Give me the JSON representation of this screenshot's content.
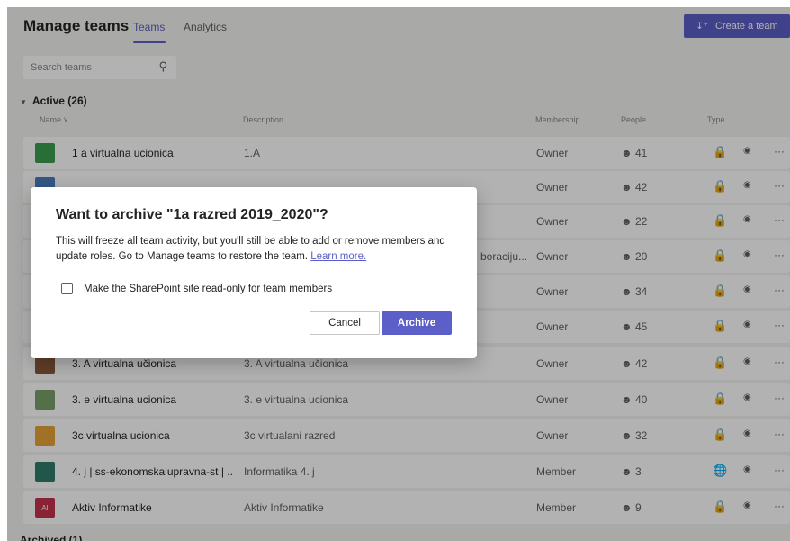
{
  "header": {
    "title": "Manage teams",
    "tabs": [
      {
        "label": "Teams",
        "active": true
      },
      {
        "label": "Analytics",
        "active": false
      }
    ],
    "create_button": {
      "label": "Create a team",
      "icon": "add-team-icon"
    }
  },
  "search": {
    "placeholder": "Search teams",
    "icon": "search-icon"
  },
  "section": {
    "active_label": "Active (26)",
    "archived_label": "Archived (1)"
  },
  "columns": {
    "name": "Name",
    "description": "Description",
    "membership": "Membership",
    "people": "People",
    "type": "Type"
  },
  "rows": [
    {
      "name": "1 a virtualna ucionica",
      "description": "1.A",
      "membership": "Owner",
      "people": "41",
      "type": "lock",
      "avatar_color": "#3b9e4e",
      "avatar_text": ""
    },
    {
      "name": "",
      "description": "",
      "membership": "Owner",
      "people": "42",
      "type": "lock",
      "avatar_color": "#4a7fbd",
      "avatar_text": ""
    },
    {
      "name": "",
      "description": "",
      "membership": "Owner",
      "people": "22",
      "type": "lock",
      "avatar_color": "#6b6b6b",
      "avatar_text": ""
    },
    {
      "name": "",
      "description": "",
      "membership": "Owner",
      "people": "20",
      "type": "lock",
      "avatar_color": "#6b6b6b",
      "avatar_text": ""
    },
    {
      "name": "",
      "description": "",
      "membership": "Owner",
      "people": "34",
      "type": "lock",
      "avatar_color": "#6b6b6b",
      "avatar_text": ""
    },
    {
      "name": "",
      "description": "",
      "membership": "Owner",
      "people": "45",
      "type": "lock",
      "avatar_color": "#6b6b6b",
      "avatar_text": ""
    },
    {
      "name": "3. A virtualna učionica",
      "description": "3. A virtualna učionica",
      "membership": "Owner",
      "people": "42",
      "type": "lock",
      "avatar_color": "#8a5a3c",
      "avatar_text": ""
    },
    {
      "name": "3. e virtualna ucionica",
      "description": "3. e virtualna ucionica",
      "membership": "Owner",
      "people": "40",
      "type": "lock",
      "avatar_color": "#7aa06b",
      "avatar_text": ""
    },
    {
      "name": "3c virtualna ucionica",
      "description": "3c virtualani razred",
      "membership": "Owner",
      "people": "32",
      "type": "lock",
      "avatar_color": "#e8a23a",
      "avatar_text": ""
    },
    {
      "name": "4. j | ss-ekonomskaiupravna-st | ...",
      "description": "Informatika 4. j",
      "membership": "Member",
      "people": "3",
      "type": "globe",
      "avatar_color": "#2f7d6a",
      "avatar_text": ""
    },
    {
      "name": "Aktiv Informatike",
      "description": "Aktiv Informatike",
      "membership": "Member",
      "people": "9",
      "type": "lock",
      "avatar_color": "#c4314b",
      "avatar_text": "AI"
    }
  ],
  "partial_text": {
    "row4_description_fragment": "boraciju..."
  },
  "dialog": {
    "title": "Want to archive \"1a razred 2019_2020\"?",
    "body_line": "This will freeze all team activity, but you'll still be able to add or remove members and update roles. Go to Manage teams to restore the team.",
    "link": "Learn more.",
    "checkbox_label": "Make the SharePoint site read-only for team members",
    "checkbox_checked": false,
    "cancel_label": "Cancel",
    "archive_label": "Archive"
  },
  "colors": {
    "accent": "#5b5fc7",
    "background": "#f3f2f1"
  }
}
